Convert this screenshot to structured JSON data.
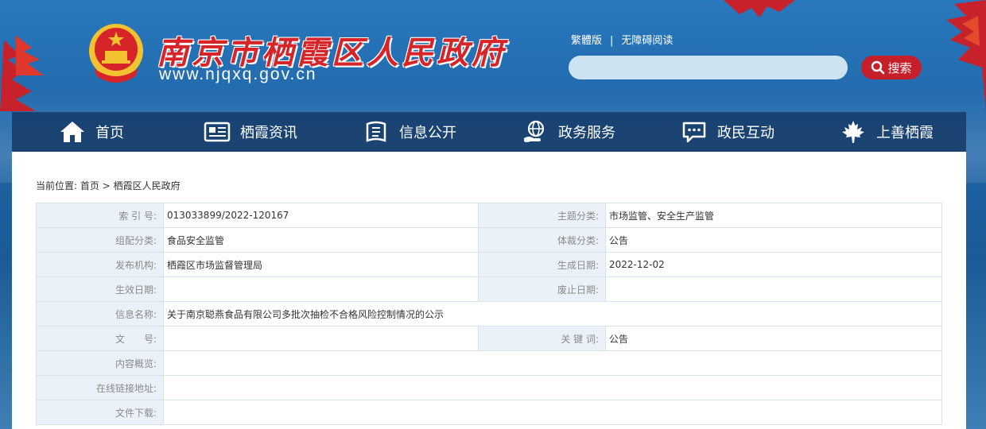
{
  "header": {
    "site_title": "南京市栖霞区人民政府",
    "site_url": "www.njqxq.gov.cn",
    "traditional_link": "繁體版",
    "separator": "|",
    "accessibility_link": "无障碍阅读",
    "search_placeholder": "",
    "search_button": "搜索"
  },
  "nav": {
    "items": [
      {
        "label": "首页",
        "icon": "home-icon"
      },
      {
        "label": "栖霞资讯",
        "icon": "newspaper-icon"
      },
      {
        "label": "信息公开",
        "icon": "info-book-icon"
      },
      {
        "label": "政务服务",
        "icon": "globe-hand-icon"
      },
      {
        "label": "政民互动",
        "icon": "chat-icon"
      },
      {
        "label": "上善栖霞",
        "icon": "maple-leaf-icon"
      }
    ]
  },
  "breadcrumb": {
    "prefix": "当前位置:",
    "home": "首页",
    "arrow": ">",
    "current": "栖霞区人民政府"
  },
  "info": {
    "index_no_label": "索 引 号:",
    "index_no": "013033899/2022-120167",
    "topic_label": "主题分类:",
    "topic": "市场监管、安全生产监管",
    "org_category_label": "组配分类:",
    "org_category": "食品安全监管",
    "genre_label": "体裁分类:",
    "genre": "公告",
    "publisher_label": "发布机构:",
    "publisher": "栖霞区市场监督管理局",
    "created_label": "生成日期:",
    "created": "2022-12-02",
    "effective_label": "生效日期:",
    "effective": "",
    "abolished_label": "废止日期:",
    "abolished": "",
    "name_label": "信息名称:",
    "name": "关于南京聪燕食品有限公司多批次抽检不合格风险控制情况的公示",
    "doc_no_label": "文　　号:",
    "doc_no": "",
    "keywords_label": "关 键 词:",
    "keywords": "公告",
    "summary_label": "内容概览:",
    "summary": "",
    "link_label": "在线链接地址:",
    "link": "",
    "download_label": "文件下载:",
    "download": ""
  },
  "colors": {
    "brand_red": "#d62428",
    "nav_bg": "#123460",
    "label_bg": "#eaf1f8"
  }
}
